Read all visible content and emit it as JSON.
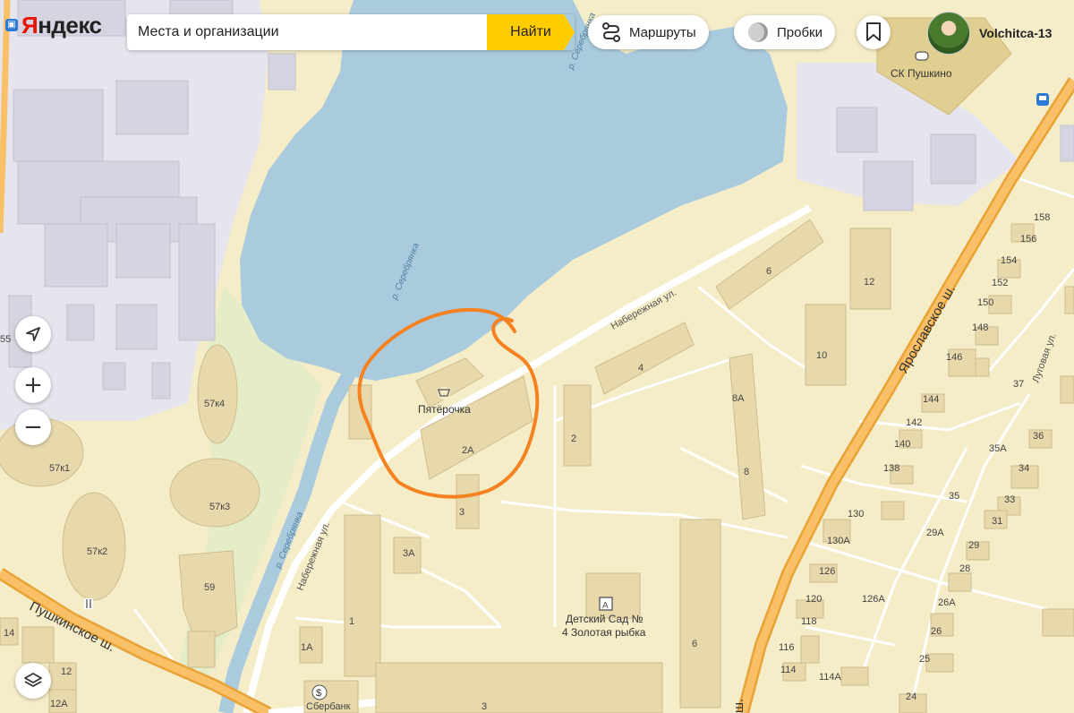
{
  "header": {
    "logo_text": "Яндекс",
    "search_placeholder": "Места и организации",
    "search_button": "Найти",
    "routes_label": "Маршруты",
    "traffic_label": "Пробки",
    "user_name": "Volchitca-13"
  },
  "controls": {
    "locate": "locate-arrow-icon",
    "zoom_in": "+",
    "zoom_out": "−",
    "layers": "layers-icon"
  },
  "map": {
    "colors": {
      "land": "#f5ecc8",
      "water": "#aacbde",
      "park": "#e3edc6",
      "industrial": "#e8e7ef",
      "building": "#e8d9ad",
      "major_road": "#f5b24a",
      "annotation": "#f58220"
    },
    "streets": {
      "naberezhnaya_top": "Набережная ул.",
      "naberezhnaya_bottom": "Набережная ул.",
      "yaroslavskoe": "Ярославское ш.",
      "pushkinskoe": "Пушкинское ш.",
      "lugovaya": "Луговая ул.",
      "river_1": "р. Серебрянка",
      "river_2": "р. Серебрянка",
      "river_3": "р. Серебрянка"
    },
    "pois": {
      "pyaterochka": "Пятёрочка",
      "sk_pushkino": "СК Пушкино",
      "kindergarten_1": "Детский Сад №",
      "kindergarten_2": "4 Золотая рыбка",
      "sberbank": "Сбербанк"
    },
    "house_numbers": {
      "h6": "6",
      "h4": "4",
      "h12": "12",
      "h10": "10",
      "h8A": "8А",
      "h8": "8",
      "h2": "2",
      "h2A": "2А",
      "h3": "3",
      "h3A": "3А",
      "h1": "1",
      "h1A": "1А",
      "h3b": "3",
      "h6b": "6",
      "h57k4": "57к4",
      "h57k1": "57к1",
      "h57k3": "57к3",
      "h57k2": "57к2",
      "h59": "59",
      "h55": "55",
      "h14": "14",
      "h12b": "12",
      "h12A": "12А",
      "h158": "158",
      "h156": "156",
      "h154": "154",
      "h152": "152",
      "h150": "150",
      "h148": "148",
      "h146": "146",
      "h144": "144",
      "h142": "142",
      "h140": "140",
      "h138": "138",
      "h130": "130",
      "h130A": "130А",
      "h126": "126",
      "h126A": "126А",
      "h120": "120",
      "h118": "118",
      "h116": "116",
      "h114": "114",
      "h114A": "114А",
      "h37": "37",
      "h36": "36",
      "h35A": "35А",
      "h34": "34",
      "h35": "35",
      "h33": "33",
      "h31": "31",
      "h29A": "29А",
      "h29": "29",
      "h28": "28",
      "h26A": "26А",
      "h26": "26",
      "h25": "25",
      "h24": "24",
      "sh": "ш."
    }
  }
}
